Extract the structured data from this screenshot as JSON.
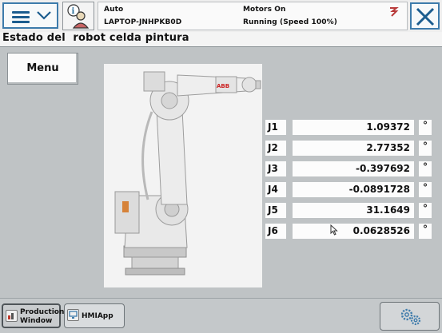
{
  "header": {
    "mode": "Auto",
    "host": "LAPTOP-JNHPKB0D",
    "motors": "Motors On",
    "state": "Running (Speed 100%)",
    "icons": {
      "main_menu": "hamburger-menu-icon",
      "user": "user-info-icon",
      "signal": "robot-signal-icon",
      "close": "close-icon"
    }
  },
  "page": {
    "title": "Estado del  robot celda pintura",
    "menu_button_label": "Menu",
    "robot_image": "abb-robot-image"
  },
  "joints": [
    {
      "name": "J1",
      "value": "1.09372",
      "unit": "°"
    },
    {
      "name": "J2",
      "value": "2.77352",
      "unit": "°"
    },
    {
      "name": "J3",
      "value": "-0.397692",
      "unit": "°"
    },
    {
      "name": "J4",
      "value": "-0.0891728",
      "unit": "°"
    },
    {
      "name": "J5",
      "value": "31.1649",
      "unit": "°"
    },
    {
      "name": "J6",
      "value": "0.0628526",
      "unit": "°"
    }
  ],
  "taskbar": {
    "production_line1": "Production",
    "production_line2": "Window",
    "hmi_label": "HMIApp",
    "quickset_icon": "quickset-gears-icon"
  },
  "colors": {
    "accent": "#3d7bab",
    "background": "#bfc3c5",
    "panel": "#fcfcfc"
  }
}
